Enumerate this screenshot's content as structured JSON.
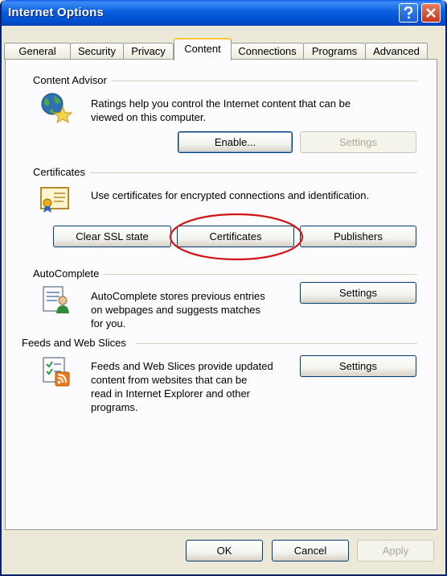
{
  "window": {
    "title": "Internet Options"
  },
  "tabs": [
    {
      "label": "General"
    },
    {
      "label": "Security"
    },
    {
      "label": "Privacy"
    },
    {
      "label": "Content"
    },
    {
      "label": "Connections"
    },
    {
      "label": "Programs"
    },
    {
      "label": "Advanced"
    }
  ],
  "content_advisor": {
    "title": "Content Advisor",
    "description_line1": "Ratings help you control the Internet content that can be",
    "description_line2": "viewed on this computer.",
    "enable_label": "Enable...",
    "settings_label": "Settings"
  },
  "certificates": {
    "title": "Certificates",
    "description": "Use certificates for encrypted connections and identification.",
    "clear_ssl_label": "Clear SSL state",
    "certificates_label": "Certificates",
    "publishers_label": "Publishers"
  },
  "autocomplete": {
    "title": "AutoComplete",
    "description_line1": "AutoComplete stores previous entries",
    "description_line2": "on webpages and suggests matches",
    "description_line3": "for you.",
    "settings_label": "Settings"
  },
  "feeds": {
    "title": "Feeds and Web Slices",
    "description_line1": "Feeds and Web Slices provide updated",
    "description_line2": "content from websites that can be",
    "description_line3": "read in Internet Explorer and other",
    "description_line4": "programs.",
    "settings_label": "Settings"
  },
  "footer": {
    "ok_label": "OK",
    "cancel_label": "Cancel",
    "apply_label": "Apply"
  },
  "colors": {
    "titlebar": "#0050d0",
    "annotation_circle": "#d21414",
    "active_tab_accent": "#ffc83c"
  }
}
